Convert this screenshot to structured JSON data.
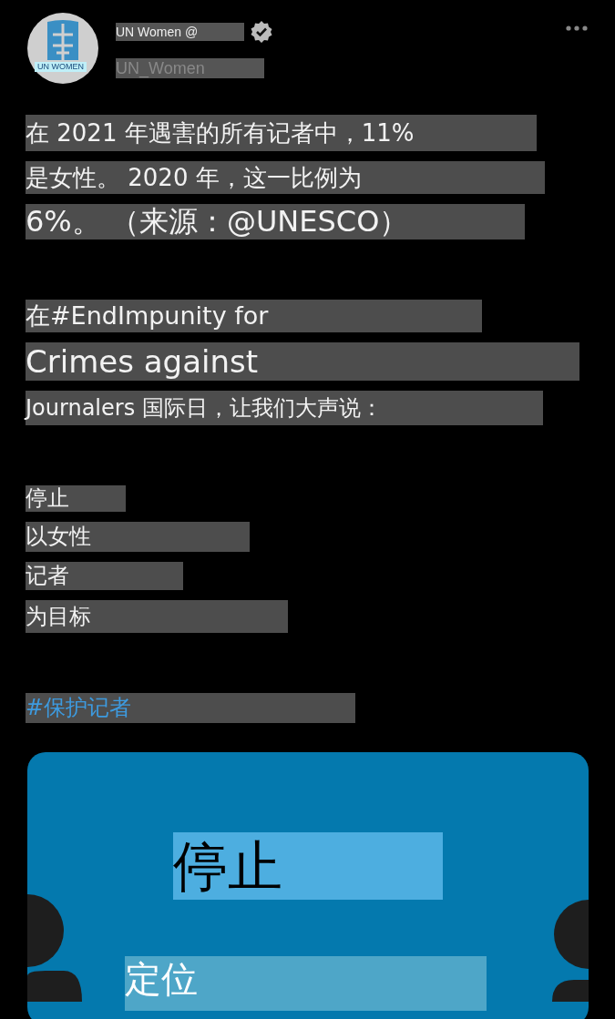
{
  "author": {
    "logo_text": "UN WOMEN",
    "name": "UN Women @",
    "verified": true,
    "handle": "UN_Women"
  },
  "paragraphs": [
    [
      {
        "kind": "text",
        "text": "在 2021 年遇害的所有记者中，11%"
      },
      {
        "kind": "text",
        "text": "是女性。 2020 年，这一比例为"
      },
      {
        "kind": "text",
        "text": "6%。 （来源：@UNESCO）"
      }
    ],
    [
      {
        "kind": "text",
        "text": "在#EndImpunity for"
      },
      {
        "kind": "text",
        "text": "Crimes against"
      },
      {
        "kind": "text",
        "text": "Journalers 国际日，让我们大声说："
      }
    ],
    [
      {
        "kind": "text",
        "text": "停止"
      },
      {
        "kind": "text",
        "text": "以女性"
      },
      {
        "kind": "text",
        "text": "记者"
      },
      {
        "kind": "text",
        "text": "为目标"
      }
    ],
    [
      {
        "kind": "hashtag",
        "text": "#保护记者"
      }
    ]
  ],
  "image": {
    "headline": "停止",
    "subline": "定位"
  }
}
